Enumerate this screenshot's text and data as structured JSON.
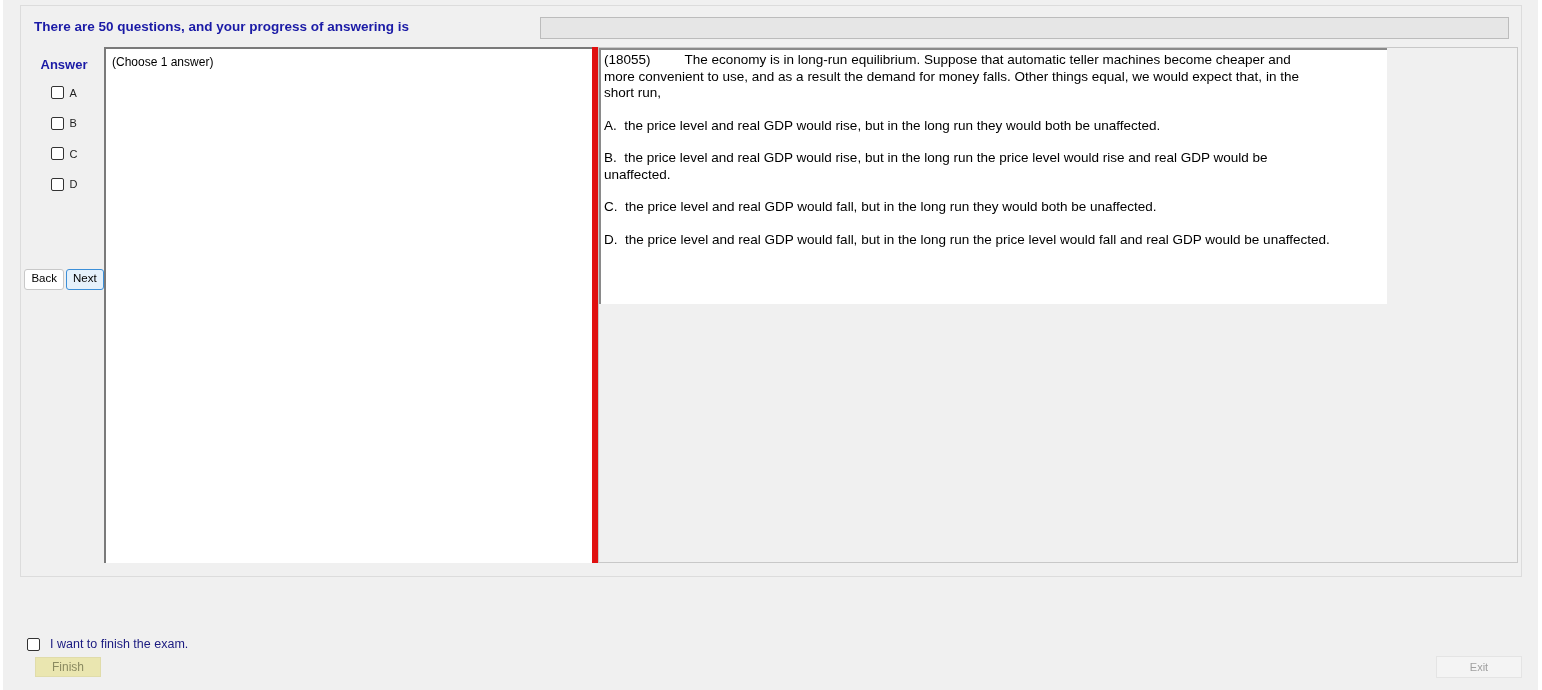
{
  "header": {
    "text": "There are 50 questions, and your progress of answering is",
    "progress": {
      "level": 0
    }
  },
  "answer_panel": {
    "title": "Answer",
    "options": [
      {
        "label": "A",
        "checked": false
      },
      {
        "label": "B",
        "checked": false
      },
      {
        "label": "C",
        "checked": false
      },
      {
        "label": "D",
        "checked": false
      }
    ],
    "buttons": [
      {
        "label": "Back",
        "selected": false
      },
      {
        "label": "Next",
        "selected": true
      }
    ]
  },
  "answer_box": {
    "value": "(Choose 1 answer)"
  },
  "question": {
    "number": "(18055)",
    "stem": "The economy is in long-run equilibrium. Suppose that automatic teller machines become cheaper and more convenient to use, and as a result the demand for money falls. Other things equal, we would expect that, in the short run,",
    "choices": [
      "A.  the price level and real GDP would rise, but in the long run they would both be unaffected.",
      "B.  the price level and real GDP would rise, but in the long run the price level would rise and real GDP would be unaffected.",
      "C.  the price level and real GDP would fall, but in the long run they would both be unaffected.",
      "D.  the price level and real GDP would fall, but in the long run the price level would fall and real GDP would be unaffected."
    ]
  },
  "finish": {
    "label": "I want to finish the exam.",
    "checked": false,
    "button": {
      "label": "Finish",
      "disabled": true
    }
  },
  "exit_button": {
    "label": "Exit",
    "disabled": true
  }
}
